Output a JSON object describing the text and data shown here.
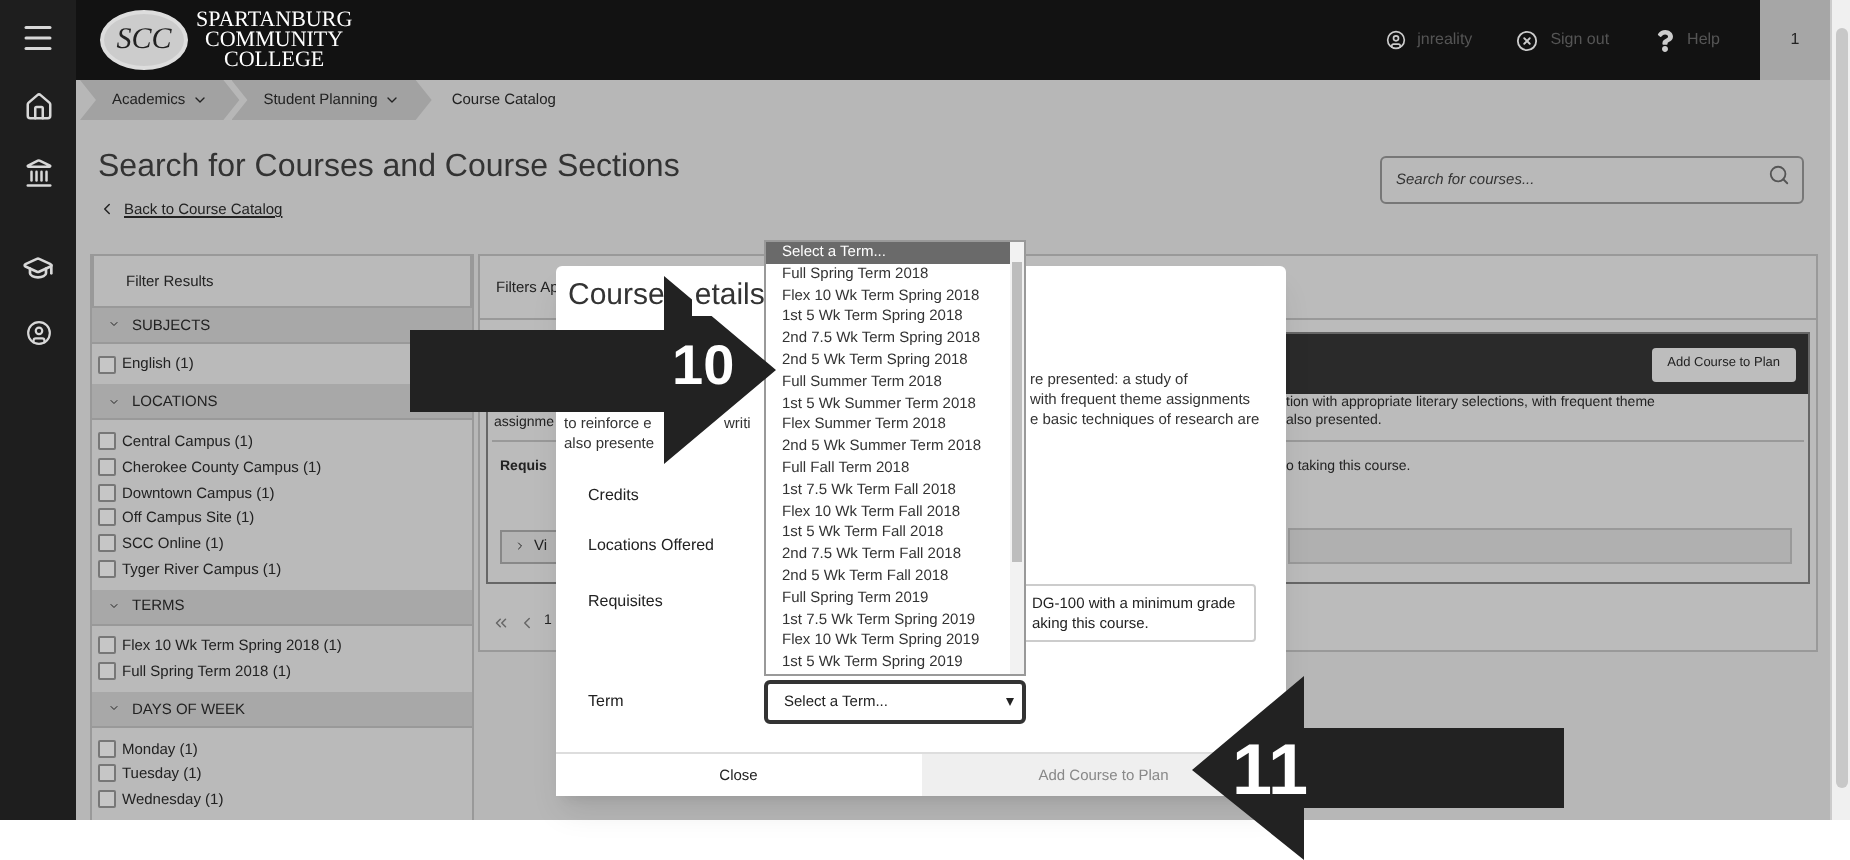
{
  "header": {
    "logo_mark": "SCC",
    "logo_lines": [
      "SPARTANBURG",
      "COMMUNITY",
      "COLLEGE"
    ],
    "user": "jnreality",
    "sign_out": "Sign out",
    "help": "Help",
    "badge": "1"
  },
  "breadcrumbs": [
    {
      "label": "Academics",
      "kind": "menu"
    },
    {
      "label": "Student Planning",
      "kind": "menu"
    },
    {
      "label": "Course Catalog",
      "kind": "current"
    }
  ],
  "page": {
    "title": "Search for Courses and Course Sections",
    "back_link": "Back to Course Catalog",
    "search": {
      "placeholder": "Search for courses..."
    }
  },
  "filters": {
    "title": "Filter Results",
    "groups": [
      {
        "heading": "SUBJECTS",
        "expanded": true,
        "options": [
          {
            "label": "English (1)",
            "checked": false
          }
        ]
      },
      {
        "heading": "LOCATIONS",
        "expanded": true,
        "options": [
          {
            "label": "Central Campus (1)",
            "checked": false
          },
          {
            "label": "Cherokee County Campus (1)",
            "checked": false
          },
          {
            "label": "Downtown Campus (1)",
            "checked": false
          },
          {
            "label": "Off Campus Site (1)",
            "checked": false
          },
          {
            "label": "SCC Online (1)",
            "checked": false
          },
          {
            "label": "Tyger River Campus (1)",
            "checked": false
          }
        ]
      },
      {
        "heading": "TERMS",
        "expanded": true,
        "options": [
          {
            "label": "Flex 10 Wk Term Spring 2018 (1)",
            "checked": false
          },
          {
            "label": "Full Spring Term 2018 (1)",
            "checked": false
          }
        ]
      },
      {
        "heading": "DAYS OF WEEK",
        "expanded": true,
        "options": [
          {
            "label": "Monday (1)",
            "checked": false
          },
          {
            "label": "Tuesday (1)",
            "checked": false
          },
          {
            "label": "Wednesday (1)",
            "checked": false
          }
        ]
      }
    ]
  },
  "results": {
    "header": "Filters Ap",
    "add_button": "Add Course to Plan",
    "description_left": [
      "assignme"
    ],
    "description_right": [
      "tion with appropriate literary selections, with frequent theme",
      "also presented."
    ],
    "requisites_label": "Requis",
    "requisites_right": "o taking this course.",
    "sections_button": "Vi",
    "page": "1"
  },
  "modal": {
    "title_parts": [
      "Course",
      "etails"
    ],
    "description_left": [
      "to reinforce e",
      "also presente"
    ],
    "description_mid": [
      "writi"
    ],
    "description_right": [
      "re presented: a study of",
      "with frequent theme assignments",
      "e basic techniques of research are"
    ],
    "fields": [
      {
        "label": "Credits"
      },
      {
        "label": "Locations Offered"
      },
      {
        "label": "Requisites",
        "value_lines": [
          "DG-100 with a minimum grade",
          "aking this course."
        ]
      },
      {
        "label": "Term"
      }
    ],
    "term_select": {
      "value": "Select a Term...",
      "expanded": true,
      "options": [
        {
          "label": "Select a Term...",
          "selected": true
        },
        {
          "label": "Full Spring Term 2018",
          "selected": false
        },
        {
          "label": "Flex 10 Wk Term Spring 2018",
          "selected": false
        },
        {
          "label": "1st 5 Wk Term Spring 2018",
          "selected": false
        },
        {
          "label": "2nd 7.5 Wk Term Spring 2018",
          "selected": false
        },
        {
          "label": "2nd 5 Wk Term Spring 2018",
          "selected": false
        },
        {
          "label": "Full Summer Term 2018",
          "selected": false
        },
        {
          "label": "1st 5 Wk Summer Term 2018",
          "selected": false
        },
        {
          "label": "Flex Summer Term 2018",
          "selected": false
        },
        {
          "label": "2nd 5 Wk Summer Term 2018",
          "selected": false
        },
        {
          "label": "Full Fall Term 2018",
          "selected": false
        },
        {
          "label": "1st 7.5 Wk Term Fall 2018",
          "selected": false
        },
        {
          "label": "Flex 10 Wk Term Fall 2018",
          "selected": false
        },
        {
          "label": "1st 5 Wk Term Fall 2018",
          "selected": false
        },
        {
          "label": "2nd 7.5 Wk Term Fall 2018",
          "selected": false
        },
        {
          "label": "2nd 5 Wk Term Fall 2018",
          "selected": false
        },
        {
          "label": "Full Spring Term 2019",
          "selected": false
        },
        {
          "label": "1st 7.5 Wk Term Spring 2019",
          "selected": false
        },
        {
          "label": "Flex 10 Wk Term Spring 2019",
          "selected": false
        },
        {
          "label": "1st 5 Wk Term Spring 2019",
          "selected": false
        }
      ]
    },
    "buttons": [
      {
        "label": "Close",
        "disabled": false
      },
      {
        "label": "Add Course to Plan",
        "disabled": true
      }
    ]
  },
  "callouts": [
    {
      "number": "10",
      "kind": "right-arrow"
    },
    {
      "number": "11",
      "kind": "left-arrow"
    }
  ]
}
